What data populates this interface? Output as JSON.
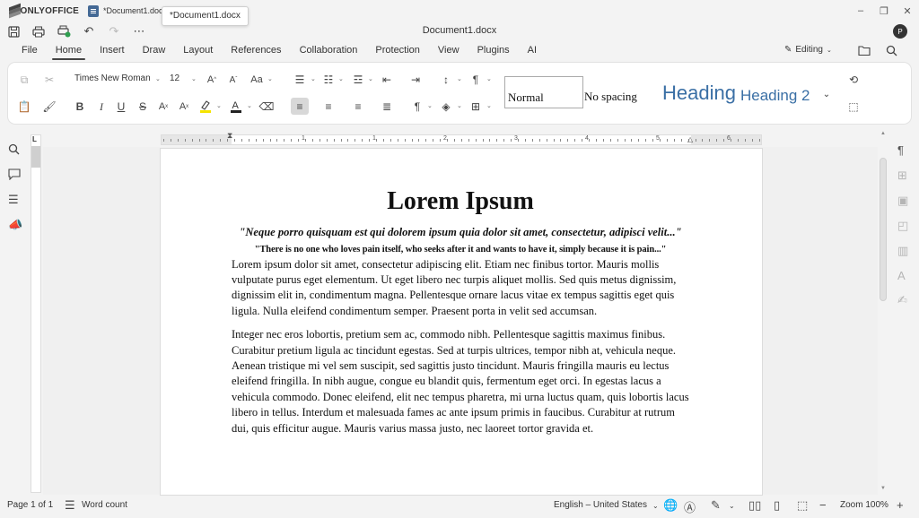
{
  "app": {
    "name": "ONLYOFFICE",
    "tab_label": "*Document1.docx",
    "tooltip": "*Document1.docx",
    "document_title": "Document1.docx",
    "user_initial": "P"
  },
  "menu": {
    "items": [
      "File",
      "Home",
      "Insert",
      "Draw",
      "Layout",
      "References",
      "Collaboration",
      "Protection",
      "View",
      "Plugins",
      "AI"
    ],
    "active": "Home",
    "editing_label": "Editing"
  },
  "toolbar": {
    "font_name": "Times New Roman",
    "font_size": "12",
    "styles": {
      "normal": "Normal",
      "no_spacing": "No spacing",
      "heading1": "Heading",
      "heading2": "Heading 2"
    }
  },
  "ruler": {
    "numbers": [
      "1",
      "1",
      "2",
      "3",
      "4",
      "5",
      "6",
      "7"
    ]
  },
  "document": {
    "title": "Lorem Ipsum",
    "quote1": "\"Neque porro quisquam est qui dolorem ipsum quia dolor sit amet, consectetur, adipisci velit...\"",
    "quote2": "\"There is no one who loves pain itself, who seeks after it and wants to have it, simply because it is pain...\"",
    "para1": "Lorem ipsum dolor sit amet, consectetur adipiscing elit. Etiam nec finibus tortor. Mauris mollis vulputate purus eget elementum. Ut eget libero nec turpis aliquet mollis. Sed quis metus dignissim, dignissim elit in, condimentum magna. Pellentesque ornare lacus vitae ex tempus sagittis eget quis ligula. Nulla eleifend condimentum semper. Praesent porta in velit sed accumsan.",
    "para2": "Integer nec eros lobortis, pretium sem ac, commodo nibh. Pellentesque sagittis maximus finibus. Curabitur pretium ligula ac tincidunt egestas. Sed at turpis ultrices, tempor nibh at, vehicula neque. Aenean tristique mi vel sem suscipit, sed sagittis justo tincidunt. Mauris fringilla mauris eu lectus eleifend fringilla. In nibh augue, congue eu blandit quis, fermentum eget orci. In egestas lacus a vehicula commodo. Donec eleifend, elit nec tempus pharetra, mi urna luctus quam, quis lobortis lacus libero in tellus. Interdum et malesuada fames ac ante ipsum primis in faucibus. Curabitur at rutrum dui, quis efficitur augue. Mauris varius massa justo, nec laoreet tortor gravida et."
  },
  "status": {
    "page": "Page 1 of 1",
    "word_count": "Word count",
    "language": "English – United States",
    "zoom": "Zoom 100%"
  },
  "colors": {
    "heading_blue": "#3a6fa5",
    "doc_icon_blue": "#446995",
    "accent_green": "#2e9e4f"
  }
}
